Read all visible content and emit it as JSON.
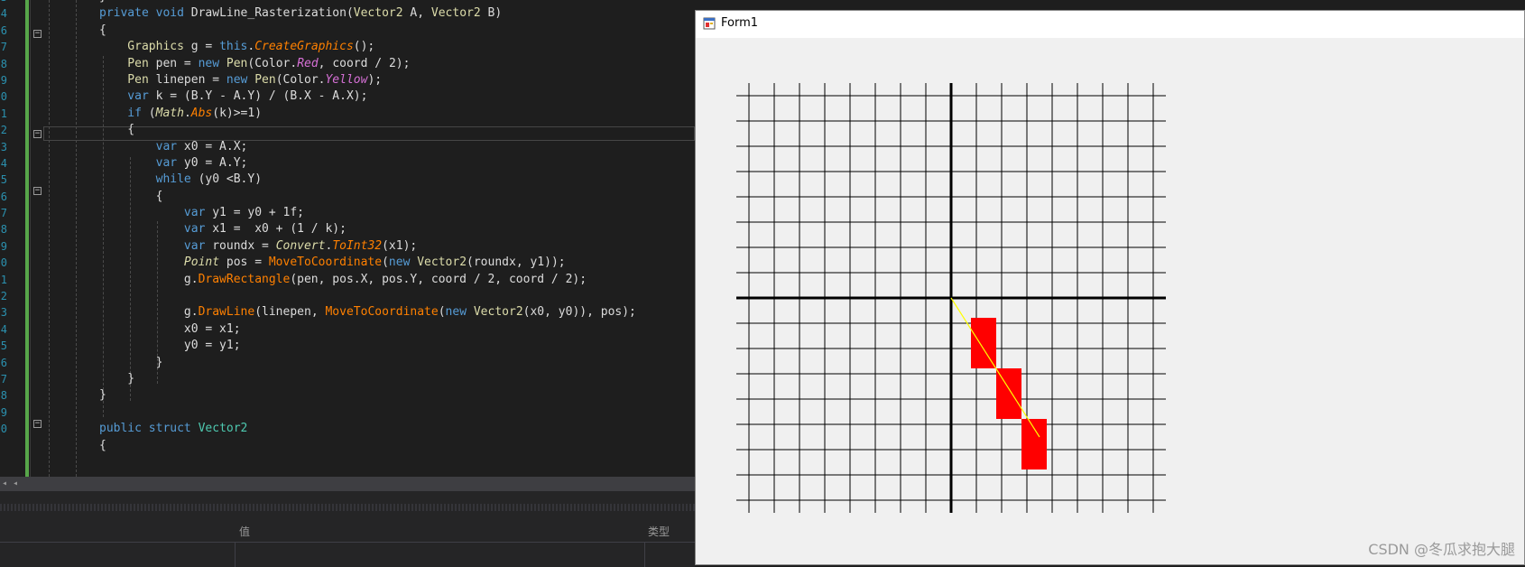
{
  "editor": {
    "line_numbers": [
      "3",
      "4",
      "6",
      "7",
      "8",
      "9",
      "0",
      "1",
      "2",
      "3",
      "4",
      "5",
      "6",
      "7",
      "8",
      "9",
      "0",
      "1",
      "2",
      "3",
      "4",
      "5",
      "6",
      "7",
      "8",
      "9",
      "0"
    ],
    "code_lines": [
      [
        {
          "t": "}",
          "c": "id"
        }
      ],
      [
        {
          "t": "private ",
          "c": "kw"
        },
        {
          "t": "void ",
          "c": "kw"
        },
        {
          "t": "DrawLine_Rasterization",
          "c": "id"
        },
        {
          "t": "(",
          "c": "id"
        },
        {
          "t": "Vector2",
          "c": "yl"
        },
        {
          "t": " A, ",
          "c": "id"
        },
        {
          "t": "Vector2",
          "c": "yl"
        },
        {
          "t": " B)",
          "c": "id"
        }
      ],
      [
        {
          "t": "{",
          "c": "id"
        }
      ],
      [
        {
          "t": "    Graphics",
          "c": "yl"
        },
        {
          "t": " g = ",
          "c": "id"
        },
        {
          "t": "this",
          "c": "kw"
        },
        {
          "t": ".",
          "c": "id"
        },
        {
          "t": "CreateGraphics",
          "c": "or it"
        },
        {
          "t": "();",
          "c": "id"
        }
      ],
      [
        {
          "t": "    Pen",
          "c": "yl"
        },
        {
          "t": " pen = ",
          "c": "id"
        },
        {
          "t": "new ",
          "c": "kw"
        },
        {
          "t": "Pen",
          "c": "yl"
        },
        {
          "t": "(Color.",
          "c": "id"
        },
        {
          "t": "Red",
          "c": "mg it"
        },
        {
          "t": ", coord / 2);",
          "c": "id"
        }
      ],
      [
        {
          "t": "    Pen",
          "c": "yl"
        },
        {
          "t": " linepen = ",
          "c": "id"
        },
        {
          "t": "new ",
          "c": "kw"
        },
        {
          "t": "Pen",
          "c": "yl"
        },
        {
          "t": "(Color.",
          "c": "id"
        },
        {
          "t": "Yellow",
          "c": "mg it"
        },
        {
          "t": ");",
          "c": "id"
        }
      ],
      [
        {
          "t": "    var ",
          "c": "kw"
        },
        {
          "t": "k = (B.Y - A.Y) / (B.X - A.X);",
          "c": "id"
        }
      ],
      [
        {
          "t": "    if ",
          "c": "kw"
        },
        {
          "t": "(",
          "c": "id"
        },
        {
          "t": "Math",
          "c": "yl it"
        },
        {
          "t": ".",
          "c": "id"
        },
        {
          "t": "Abs",
          "c": "or it"
        },
        {
          "t": "(k)>=1)",
          "c": "id"
        }
      ],
      [
        {
          "t": "    {",
          "c": "id"
        }
      ],
      [
        {
          "t": "        var ",
          "c": "kw"
        },
        {
          "t": "x0 = A.X;",
          "c": "id"
        }
      ],
      [
        {
          "t": "        var ",
          "c": "kw"
        },
        {
          "t": "y0 = A.Y;",
          "c": "id"
        }
      ],
      [
        {
          "t": "        while ",
          "c": "kw"
        },
        {
          "t": "(y0 <B.Y)",
          "c": "id"
        }
      ],
      [
        {
          "t": "        {",
          "c": "id"
        }
      ],
      [
        {
          "t": "            var ",
          "c": "kw"
        },
        {
          "t": "y1 = y0 + 1f;",
          "c": "id"
        }
      ],
      [
        {
          "t": "            var ",
          "c": "kw"
        },
        {
          "t": "x1 =  x0 + (1 / k);",
          "c": "id"
        }
      ],
      [
        {
          "t": "            var ",
          "c": "kw"
        },
        {
          "t": "roundx = ",
          "c": "id"
        },
        {
          "t": "Convert",
          "c": "yl it"
        },
        {
          "t": ".",
          "c": "id"
        },
        {
          "t": "ToInt32",
          "c": "or it"
        },
        {
          "t": "(x1);",
          "c": "id"
        }
      ],
      [
        {
          "t": "            Point",
          "c": "yl it"
        },
        {
          "t": " pos = ",
          "c": "id"
        },
        {
          "t": "MoveToCoordinate",
          "c": "or"
        },
        {
          "t": "(",
          "c": "id"
        },
        {
          "t": "new ",
          "c": "kw"
        },
        {
          "t": "Vector2",
          "c": "yl"
        },
        {
          "t": "(roundx, y1));",
          "c": "id"
        }
      ],
      [
        {
          "t": "            g.",
          "c": "id"
        },
        {
          "t": "DrawRectangle",
          "c": "or"
        },
        {
          "t": "(pen, pos.X, pos.Y, coord / 2, coord / 2);",
          "c": "id"
        }
      ],
      [
        {
          "t": "",
          "c": "id"
        }
      ],
      [
        {
          "t": "            g.",
          "c": "id"
        },
        {
          "t": "DrawLine",
          "c": "or"
        },
        {
          "t": "(linepen, ",
          "c": "id"
        },
        {
          "t": "MoveToCoordinate",
          "c": "or"
        },
        {
          "t": "(",
          "c": "id"
        },
        {
          "t": "new ",
          "c": "kw"
        },
        {
          "t": "Vector2",
          "c": "yl"
        },
        {
          "t": "(x0, y0)), pos);",
          "c": "id"
        }
      ],
      [
        {
          "t": "            x0 = x1;",
          "c": "id"
        }
      ],
      [
        {
          "t": "            y0 = y1;",
          "c": "id"
        }
      ],
      [
        {
          "t": "        }",
          "c": "id"
        }
      ],
      [
        {
          "t": "    }",
          "c": "id"
        }
      ],
      [
        {
          "t": "}",
          "c": "id"
        }
      ],
      [
        {
          "t": "",
          "c": "id"
        }
      ],
      [
        {
          "t": "public ",
          "c": "kw"
        },
        {
          "t": "struct ",
          "c": "kw"
        },
        {
          "t": "Vector2",
          "c": "ty"
        }
      ],
      [
        {
          "t": "{",
          "c": "id"
        }
      ]
    ]
  },
  "panel": {
    "col_value": "值",
    "col_type": "类型"
  },
  "form": {
    "title": "Form1",
    "watermark": "CSDN @冬瓜求抱大腿"
  },
  "grid": {
    "cells": 16,
    "axis_x_index": 8,
    "axis_y_index": 8,
    "pixel_color": "#ff0000",
    "line_color": "#ffff00"
  },
  "pixels": [
    {
      "col": 9,
      "row": 9
    },
    {
      "col": 10,
      "row": 11
    },
    {
      "col": 11,
      "row": 13
    }
  ],
  "line": {
    "from": [
      8,
      8
    ],
    "to": [
      11,
      13
    ]
  }
}
